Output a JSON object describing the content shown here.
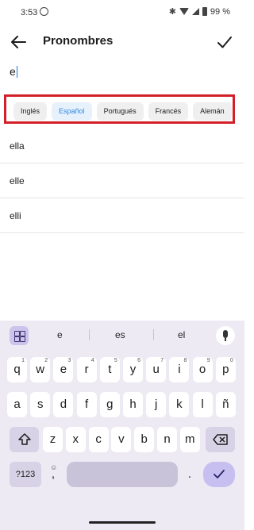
{
  "status_bar": {
    "time": "3:53",
    "battery": "99 %"
  },
  "header": {
    "title": "Pronombres"
  },
  "input": {
    "value": "e"
  },
  "languages": [
    {
      "label": "Inglés",
      "selected": false
    },
    {
      "label": "Español",
      "selected": true
    },
    {
      "label": "Portugués",
      "selected": false
    },
    {
      "label": "Francés",
      "selected": false
    },
    {
      "label": "Alemán",
      "selected": false
    }
  ],
  "suggestions_list": [
    "ella",
    "elle",
    "elli"
  ],
  "keyboard": {
    "suggestions": [
      "e",
      "es",
      "el"
    ],
    "row1": [
      [
        "q",
        "1"
      ],
      [
        "w",
        "2"
      ],
      [
        "e",
        "3"
      ],
      [
        "r",
        "4"
      ],
      [
        "t",
        "5"
      ],
      [
        "y",
        "6"
      ],
      [
        "u",
        "7"
      ],
      [
        "i",
        "8"
      ],
      [
        "o",
        "9"
      ],
      [
        "p",
        "0"
      ]
    ],
    "row2": [
      "a",
      "s",
      "d",
      "f",
      "g",
      "h",
      "j",
      "k",
      "l",
      "ñ"
    ],
    "row3": [
      "z",
      "x",
      "c",
      "v",
      "b",
      "n",
      "m"
    ],
    "symbols_key": "?123",
    "comma_key": ",",
    "period_key": "."
  },
  "colors": {
    "accent": "#2f88e0",
    "highlight_border": "#d32028",
    "keyboard_bg": "#eeeaf3"
  },
  "icons": [
    "whatsapp-icon",
    "bluetooth-icon",
    "wifi-icon",
    "signal-icon",
    "battery-icon",
    "back-arrow-icon",
    "checkmark-icon",
    "grid-icon",
    "mic-icon",
    "shift-icon",
    "backspace-icon",
    "emoji-icon",
    "enter-check-icon"
  ]
}
